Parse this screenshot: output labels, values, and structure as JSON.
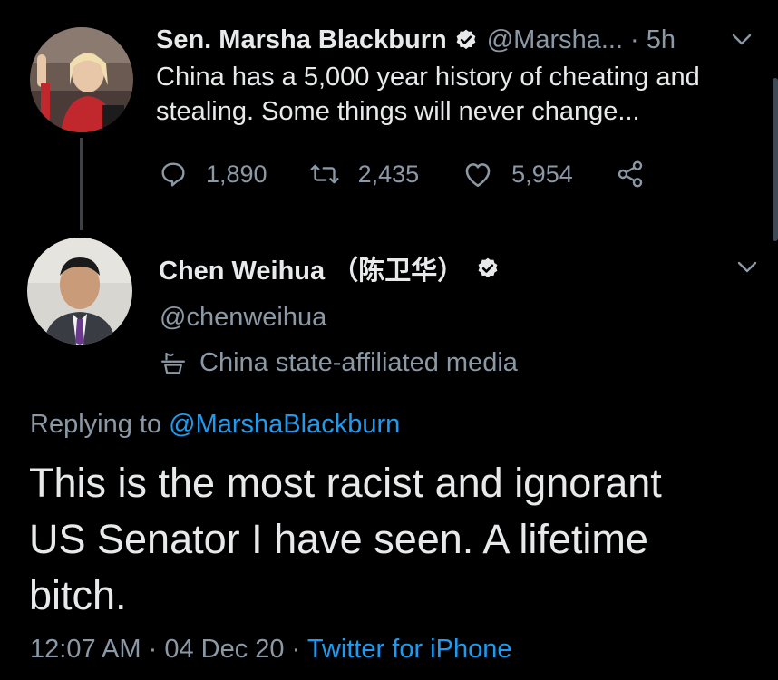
{
  "colors": {
    "background": "#000000",
    "text_primary": "#e7e9ea",
    "text_muted": "#8b98a5",
    "link": "#1d9bf0",
    "verified_badge": "#e7e9ea"
  },
  "tweet1": {
    "name": "Sen. Marsha Blackburn",
    "handle": "@Marsha...",
    "separator": "·",
    "time": "5h",
    "verified_icon": "verified-badge-icon",
    "text_lines": [
      "China has a 5,000 year history of cheating and",
      "stealing. Some things will never change..."
    ],
    "actions": {
      "reply_count": "1,890",
      "retweet_count": "2,435",
      "like_count": "5,954"
    }
  },
  "tweet2": {
    "name": "Chen Weihua （陈卫华）",
    "handle": "@chenweihua",
    "label": "China state-affiliated media",
    "replying_prefix": "Replying to",
    "replying_handle": "@MarshaBlackburn",
    "text_lines": [
      "This is the most racist and ignorant",
      "US Senator I have seen.  A lifetime",
      "bitch."
    ],
    "meta": {
      "time": "12:07 AM",
      "sep1": "·",
      "date": "04 Dec 20",
      "sep2": "·",
      "source": "Twitter for iPhone"
    }
  }
}
